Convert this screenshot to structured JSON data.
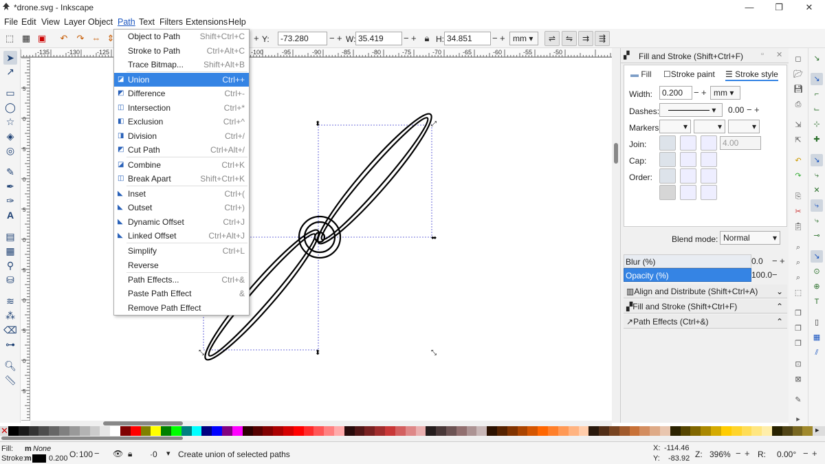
{
  "window": {
    "title": "*drone.svg - Inkscape"
  },
  "menubar": [
    "File",
    "Edit",
    "View",
    "Layer",
    "Object",
    "Path",
    "Text",
    "Filters",
    "Extensions",
    "Help"
  ],
  "toolbar": {
    "y_label": "Y:",
    "y_value": "-73.280",
    "w_label": "W:",
    "w_value": "35.419",
    "h_label": "H:",
    "h_value": "34.851",
    "unit": "mm"
  },
  "hruler_ticks": [
    "-135",
    "-130",
    "-125",
    "-100",
    "-95",
    "-90",
    "-85",
    "-80",
    "-75",
    "-70",
    "-65",
    "-60",
    "-55",
    "-50"
  ],
  "vruler_ticks": [
    "5",
    "0",
    "5",
    "0",
    "5",
    "0",
    "5",
    "0",
    "5",
    "0",
    "5"
  ],
  "path_menu": {
    "items": [
      {
        "label": "Object to Path",
        "shortcut": "Shift+Ctrl+C",
        "icon": ""
      },
      {
        "label": "Stroke to Path",
        "shortcut": "Ctrl+Alt+C",
        "icon": ""
      },
      {
        "label": "Trace Bitmap...",
        "shortcut": "Shift+Alt+B",
        "icon": ""
      },
      {
        "label": "Union",
        "shortcut": "Ctrl++",
        "icon": "◪"
      },
      {
        "label": "Difference",
        "shortcut": "Ctrl+-",
        "icon": "◩"
      },
      {
        "label": "Intersection",
        "shortcut": "Ctrl+*",
        "icon": "◫"
      },
      {
        "label": "Exclusion",
        "shortcut": "Ctrl+^",
        "icon": "◧"
      },
      {
        "label": "Division",
        "shortcut": "Ctrl+/",
        "icon": "◨"
      },
      {
        "label": "Cut Path",
        "shortcut": "Ctrl+Alt+/",
        "icon": "◩"
      },
      {
        "label": "Combine",
        "shortcut": "Ctrl+K",
        "icon": "◪"
      },
      {
        "label": "Break Apart",
        "shortcut": "Shift+Ctrl+K",
        "icon": "◫"
      },
      {
        "label": "Inset",
        "shortcut": "Ctrl+(",
        "icon": "◣"
      },
      {
        "label": "Outset",
        "shortcut": "Ctrl+)",
        "icon": "◣"
      },
      {
        "label": "Dynamic Offset",
        "shortcut": "Ctrl+J",
        "icon": "◣"
      },
      {
        "label": "Linked Offset",
        "shortcut": "Ctrl+Alt+J",
        "icon": "◣"
      },
      {
        "label": "Simplify",
        "shortcut": "Ctrl+L",
        "icon": ""
      },
      {
        "label": "Reverse",
        "shortcut": "",
        "icon": ""
      },
      {
        "label": "Path Effects...",
        "shortcut": "Ctrl+&",
        "icon": ""
      },
      {
        "label": "Paste Path Effect",
        "shortcut": "&",
        "icon": ""
      },
      {
        "label": "Remove Path Effect",
        "shortcut": "",
        "icon": ""
      }
    ]
  },
  "fill_stroke": {
    "header": "Fill and Stroke (Shift+Ctrl+F)",
    "tabs": [
      "Fill",
      "Stroke paint",
      "Stroke style"
    ],
    "width_label": "Width:",
    "width_value": "0.200",
    "width_unit": "mm",
    "dashes_label": "Dashes:",
    "dashes_value": "0.00",
    "markers_label": "Markers:",
    "join_label": "Join:",
    "join_value": "4.00",
    "cap_label": "Cap:",
    "order_label": "Order:",
    "blend_label": "Blend mode:",
    "blend_value": "Normal",
    "blur_label": "Blur (%)",
    "blur_value": "0.0",
    "opacity_label": "Opacity (%)",
    "opacity_value": "100.0"
  },
  "collapsed_panels": [
    "Align and Distribute (Shift+Ctrl+A)",
    "Fill and Stroke (Shift+Ctrl+F)",
    "Path Effects (Ctrl+&)"
  ],
  "status": {
    "fill_label": "Fill:",
    "fill_value": "None",
    "fill_prefix": "m",
    "stroke_label": "Stroke:",
    "stroke_prefix": "m",
    "stroke_width": "0.200",
    "opacity_label": "O:",
    "opacity_value": "100",
    "layer_value": "·0",
    "message": "Create union of selected paths",
    "x_label": "X:",
    "x_value": "-114.46",
    "y_label": "Y:",
    "y_value": "-83.92",
    "zoom_label": "Z:",
    "zoom_value": "396%",
    "rot_label": "R:",
    "rot_value": "0.00°"
  },
  "palette_colors": [
    "#000000",
    "#1a1a1a",
    "#333333",
    "#4d4d4d",
    "#666666",
    "#808080",
    "#999999",
    "#b3b3b3",
    "#cccccc",
    "#e6e6e6",
    "#ffffff",
    "#800000",
    "#ff0000",
    "#808000",
    "#ffff00",
    "#008000",
    "#00ff00",
    "#008080",
    "#00ffff",
    "#000080",
    "#0000ff",
    "#800080",
    "#ff00ff",
    "#2b0000",
    "#550000",
    "#800000",
    "#aa0000",
    "#d40000",
    "#ff0000",
    "#ff2a2a",
    "#ff5555",
    "#ff8080",
    "#ffaaaa",
    "#280b0b",
    "#501616",
    "#782121",
    "#a02c2c",
    "#c83737",
    "#d35f5f",
    "#de8787",
    "#e9afaf",
    "#241c1c",
    "#483737",
    "#6c5353",
    "#916f6f",
    "#ac9393",
    "#c8b7b7",
    "#2b1100",
    "#552200",
    "#803300",
    "#aa4400",
    "#d45500",
    "#ff6600",
    "#ff7f2a",
    "#ff9955",
    "#ffb380",
    "#ffccaa",
    "#28170b",
    "#502d16",
    "#784421",
    "#a05a2c",
    "#c87137",
    "#d38d5f",
    "#deaa87",
    "#e9c6af",
    "#2b2200",
    "#554400",
    "#806600",
    "#aa8800",
    "#d4aa00",
    "#ffcc00",
    "#ffd42a",
    "#ffdd55",
    "#ffe680",
    "#ffeeaa",
    "#282200",
    "#504416",
    "#786721",
    "#a0892c"
  ]
}
